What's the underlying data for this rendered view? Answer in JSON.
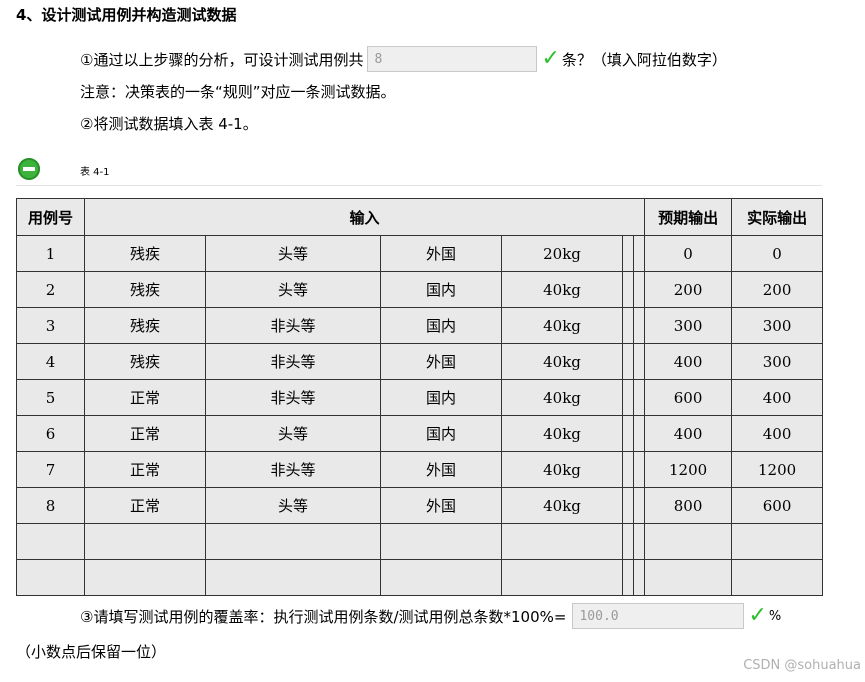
{
  "heading": "4、设计测试用例并构造测试数据",
  "q1": {
    "prefix": "①通过以上步骤的分析，可设计测试用例共",
    "value": "8",
    "suffix": "条？（填入阿拉伯数字）"
  },
  "note": "注意：决策表的一条“规则”对应一条测试数据。",
  "q2": "②将测试数据填入表 4-1。",
  "caption": "表 4-1",
  "table": {
    "headers": [
      "用例号",
      "输入",
      "预期输出",
      "实际输出"
    ],
    "rows": [
      [
        "1",
        "残疾",
        "头等",
        "外国",
        "20kg",
        "0",
        "0"
      ],
      [
        "2",
        "残疾",
        "头等",
        "国内",
        "40kg",
        "200",
        "200"
      ],
      [
        "3",
        "残疾",
        "非头等",
        "国内",
        "40kg",
        "300",
        "300"
      ],
      [
        "4",
        "残疾",
        "非头等",
        "外国",
        "40kg",
        "400",
        "300"
      ],
      [
        "5",
        "正常",
        "非头等",
        "国内",
        "40kg",
        "600",
        "400"
      ],
      [
        "6",
        "正常",
        "头等",
        "国内",
        "40kg",
        "400",
        "400"
      ],
      [
        "7",
        "正常",
        "非头等",
        "外国",
        "40kg",
        "1200",
        "1200"
      ],
      [
        "8",
        "正常",
        "头等",
        "外国",
        "40kg",
        "800",
        "600"
      ],
      [
        "",
        "",
        "",
        "",
        "",
        "",
        ""
      ],
      [
        "",
        "",
        "",
        "",
        "",
        "",
        ""
      ]
    ]
  },
  "q3": {
    "prefix": "③请填写测试用例的覆盖率：执行测试用例条数/测试用例总条数*100%=",
    "value": "100.0",
    "suffix": "%"
  },
  "q3_note": "（小数点后保留一位）",
  "watermark": "CSDN @sohuahua",
  "colors": {
    "check": "#2bbf2b",
    "table_bg": "#e9e9e9"
  }
}
